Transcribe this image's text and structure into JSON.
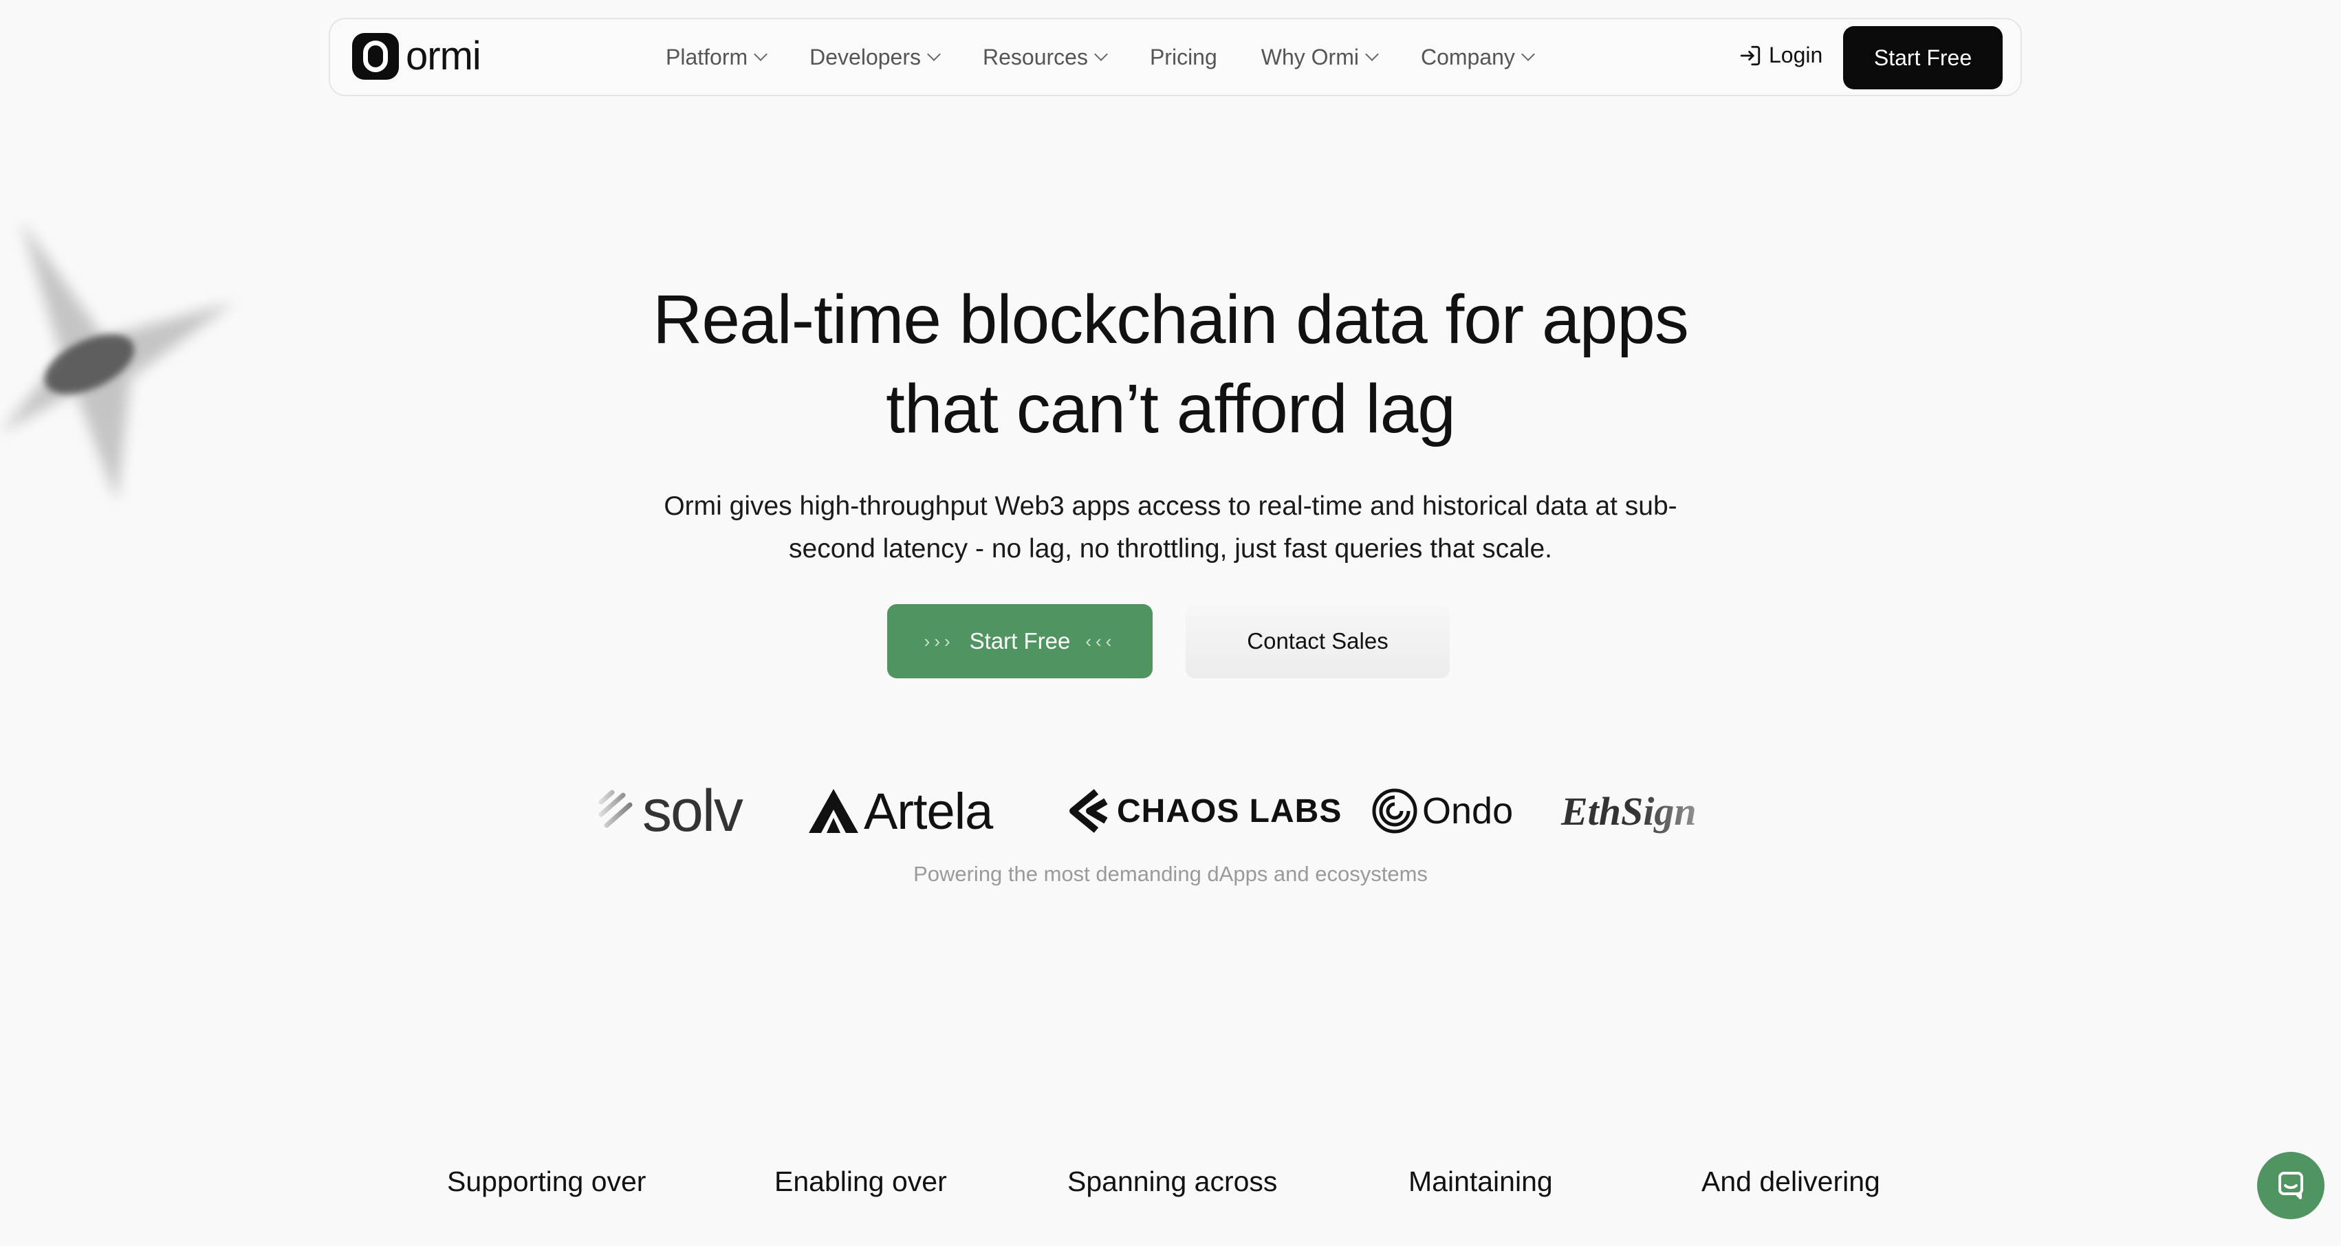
{
  "nav": {
    "logo_text": "ormi",
    "menu": [
      {
        "label": "Platform",
        "dropdown": true
      },
      {
        "label": "Developers",
        "dropdown": true
      },
      {
        "label": "Resources",
        "dropdown": true
      },
      {
        "label": "Pricing",
        "dropdown": false
      },
      {
        "label": "Why Ormi",
        "dropdown": true
      },
      {
        "label": "Company",
        "dropdown": true
      }
    ],
    "login_label": "Login",
    "start_label": "Start Free"
  },
  "hero": {
    "title_line1": "Real-time blockchain data for apps",
    "title_line2": "that can’t afford lag",
    "subtitle_line1": "Ormi gives high-throughput Web3 apps access to real-time and historical data at sub-",
    "subtitle_line2": "second latency - no lag, no throttling, just fast queries that scale.",
    "primary_button": "Start Free",
    "primary_left_arrows": "›››",
    "primary_right_arrows": "‹‹‹",
    "secondary_button": "Contact Sales"
  },
  "partners": {
    "logos": [
      "solv",
      "Artela",
      "CHAOS LABS",
      "Ondo",
      "EthSign"
    ],
    "caption": "Powering the most demanding dApps and ecosystems"
  },
  "stats": [
    "Supporting over",
    "Enabling over",
    "Spanning across",
    "Maintaining",
    "And delivering"
  ],
  "colors": {
    "accent_green": "#4f9461",
    "button_dark": "#0a0a0a",
    "background": "#f9f9f9"
  },
  "icons": {
    "login": "login-arrow-icon",
    "chat": "chat-bubble-icon"
  }
}
